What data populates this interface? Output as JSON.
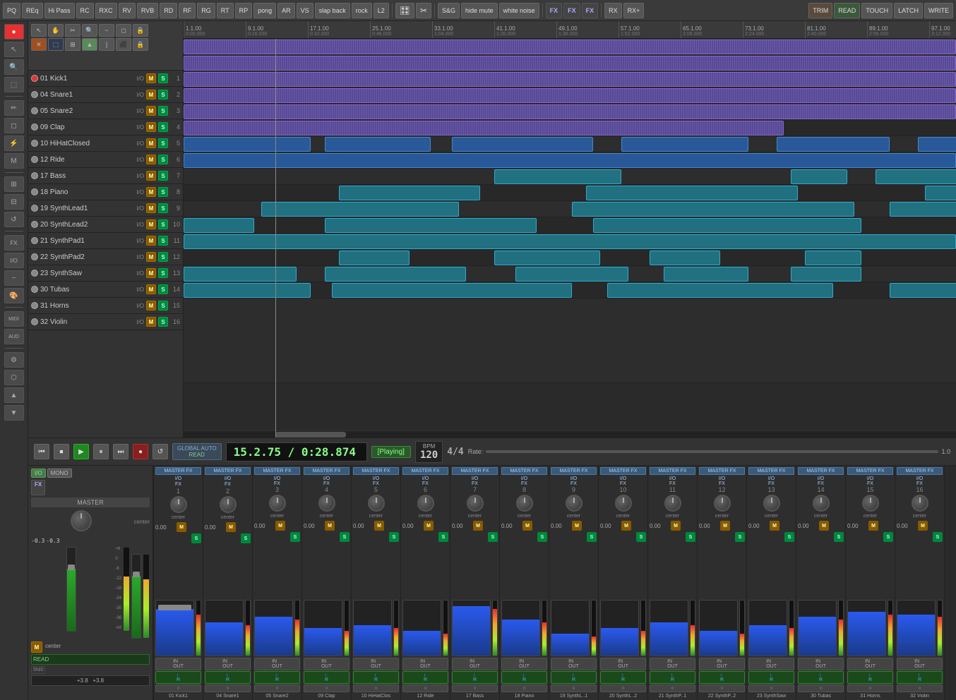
{
  "topbar": {
    "buttons": [
      "PQ",
      "REq",
      "Hi Pass",
      "RC",
      "RXC",
      "RV",
      "RVB",
      "RD",
      "RF",
      "RG",
      "RT",
      "RP",
      "pong",
      "AR",
      "VS",
      "slap back",
      "rock",
      "L2"
    ],
    "fx_buttons": [
      "FX",
      "FX",
      "FX"
    ],
    "right_buttons": [
      "TRIM",
      "READ",
      "TOUCH",
      "LATCH",
      "WRITE"
    ],
    "icon_buttons": [
      "S&G",
      "hide mute",
      "white noise",
      "RX",
      "RX+"
    ]
  },
  "tracks": [
    {
      "num": "01",
      "name": "Kick1",
      "color": "purple",
      "active": true,
      "lane_color": "purple"
    },
    {
      "num": "04",
      "name": "Snare1",
      "color": "purple",
      "active": false,
      "lane_color": "purple"
    },
    {
      "num": "05",
      "name": "Snare2",
      "color": "purple",
      "active": false,
      "lane_color": "purple"
    },
    {
      "num": "09",
      "name": "Clap",
      "color": "purple",
      "active": false,
      "lane_color": "purple"
    },
    {
      "num": "10",
      "name": "HiHatClosed",
      "color": "purple",
      "active": false,
      "lane_color": "purple"
    },
    {
      "num": "12",
      "name": "Ride",
      "color": "purple",
      "active": false,
      "lane_color": "purple"
    },
    {
      "num": "17",
      "name": "Bass",
      "color": "blue",
      "active": false,
      "lane_color": "blue"
    },
    {
      "num": "18",
      "name": "Piano",
      "color": "blue",
      "active": false,
      "lane_color": "blue"
    },
    {
      "num": "19",
      "name": "SynthLead1",
      "color": "teal",
      "active": false,
      "lane_color": "teal"
    },
    {
      "num": "20",
      "name": "SynthLead2",
      "color": "teal",
      "active": false,
      "lane_color": "teal"
    },
    {
      "num": "21",
      "name": "SynthPad1",
      "color": "teal",
      "active": false,
      "lane_color": "teal"
    },
    {
      "num": "22",
      "name": "SynthPad2",
      "color": "teal",
      "active": false,
      "lane_color": "teal"
    },
    {
      "num": "23",
      "name": "SynthSaw",
      "color": "teal",
      "active": false,
      "lane_color": "teal"
    },
    {
      "num": "30",
      "name": "Tubas",
      "color": "teal",
      "active": false,
      "lane_color": "teal"
    },
    {
      "num": "31",
      "name": "Horns",
      "color": "teal",
      "active": false,
      "lane_color": "teal"
    },
    {
      "num": "32",
      "name": "Violin",
      "color": "teal",
      "active": false,
      "lane_color": "teal"
    }
  ],
  "ruler_marks": [
    {
      "pos": 0,
      "label": "1.1.00",
      "sublabel": "0:00.000"
    },
    {
      "pos": 88,
      "label": "9.1.00",
      "sublabel": "0:16.000"
    },
    {
      "pos": 176,
      "label": "17.1.00",
      "sublabel": "0:32.000"
    },
    {
      "pos": 264,
      "label": "25.1.00",
      "sublabel": "0:48.000"
    },
    {
      "pos": 352,
      "label": "33.1.00",
      "sublabel": "1:04.000"
    },
    {
      "pos": 440,
      "label": "41.1.00",
      "sublabel": "1:20.000"
    },
    {
      "pos": 528,
      "label": "49.1.00",
      "sublabel": "1:36.000"
    },
    {
      "pos": 616,
      "label": "57.1.00",
      "sublabel": "1:52.000"
    },
    {
      "pos": 704,
      "label": "65.1.00",
      "sublabel": "2:08.000"
    },
    {
      "pos": 792,
      "label": "73.1.00",
      "sublabel": "2:24.000"
    },
    {
      "pos": 880,
      "label": "81.1.00",
      "sublabel": "2:40.000"
    },
    {
      "pos": 968,
      "label": "89.1.00",
      "sublabel": "2:56.000"
    },
    {
      "pos": 1056,
      "label": "97.1.00",
      "sublabel": "3:12.000"
    }
  ],
  "transport": {
    "time": "15.2.75 / 0:28.874",
    "status": "[Playing]",
    "bpm_label": "BPM",
    "bpm": "120",
    "signature": "4/4",
    "rate_label": "Rate:",
    "rate_value": "1.0",
    "global_label": "GLOBAL AUTO",
    "read_label": "READ"
  },
  "mixer": {
    "master_title": "MASTER",
    "master_io": "I/O",
    "master_mono": "MONO",
    "master_fx": "FX",
    "channels": [
      {
        "num": "1",
        "name": "01 Kick1",
        "vol": "0.00",
        "meter_h": 85
      },
      {
        "num": "2",
        "name": "04 Snare1",
        "vol": "0.00",
        "meter_h": 60
      },
      {
        "num": "3",
        "name": "05 Snare2",
        "vol": "0.00",
        "meter_h": 70
      },
      {
        "num": "4",
        "name": "09 Clap",
        "vol": "0.00",
        "meter_h": 50
      },
      {
        "num": "5",
        "name": "10 HiHatClos",
        "vol": "0.00",
        "meter_h": 55
      },
      {
        "num": "6",
        "name": "12 Ride",
        "vol": "0.00",
        "meter_h": 45
      },
      {
        "num": "7",
        "name": "17 Bass",
        "vol": "0.00",
        "meter_h": 90
      },
      {
        "num": "8",
        "name": "18 Piano",
        "vol": "0.00",
        "meter_h": 65
      },
      {
        "num": "9",
        "name": "19 SynthL..1",
        "vol": "0.00",
        "meter_h": 40
      },
      {
        "num": "10",
        "name": "20 SynthL..2",
        "vol": "0.00",
        "meter_h": 50
      },
      {
        "num": "11",
        "name": "21 SynthP..1",
        "vol": "0.00",
        "meter_h": 60
      },
      {
        "num": "12",
        "name": "22 SynthP..2",
        "vol": "0.00",
        "meter_h": 45
      },
      {
        "num": "13",
        "name": "23 SynthSaw",
        "vol": "0.00",
        "meter_h": 55
      },
      {
        "num": "14",
        "name": "30 Tubas",
        "vol": "0.00",
        "meter_h": 70
      },
      {
        "num": "15",
        "name": "31 Horns",
        "vol": "0.00",
        "meter_h": 80
      },
      {
        "num": "16",
        "name": "32 Violin",
        "vol": "0.00",
        "meter_h": 75
      }
    ]
  }
}
